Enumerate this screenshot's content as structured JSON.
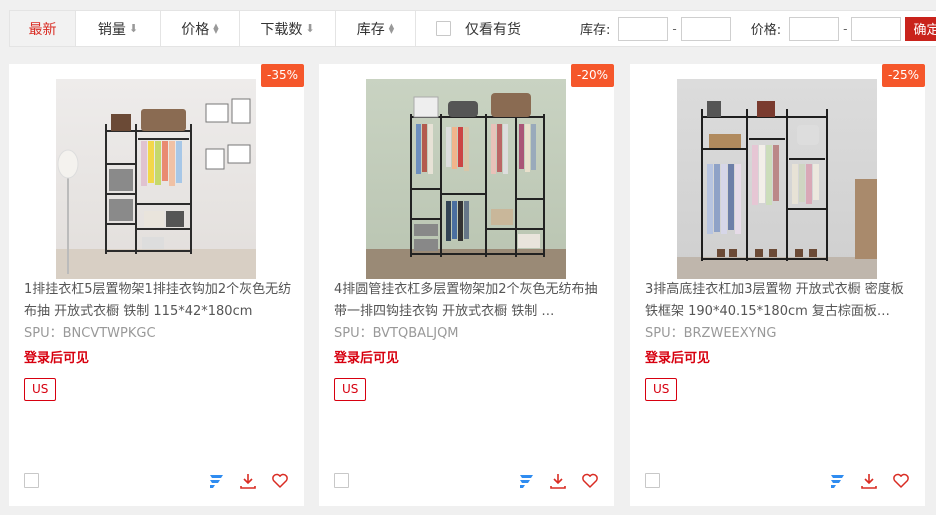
{
  "sort": {
    "newest": "最新",
    "sales": "销量",
    "price": "价格",
    "downloads": "下载数",
    "stock": "库存",
    "in_stock_only": "仅看有货",
    "stock_range_label": "库存:",
    "price_range_label": "价格:",
    "dash": "-",
    "confirm": "确定",
    "arrow_down": "⬇",
    "arrow_up_small": "▲",
    "arrow_down_small": "▼"
  },
  "colors": {
    "accent_red": "#d92c23",
    "discount_orange": "#f5572b",
    "price_red": "#d7000f",
    "brand_blue": "#2f8cf0"
  },
  "products": [
    {
      "discount": "-35%",
      "title": "1排挂衣杠5层置物架1排挂衣钩加2个灰色无纺布抽 开放式衣橱 铁制 115*42*180cm",
      "spu": "SPU：BNCVTWPKGC",
      "price_text": "登录后可见",
      "region": "US"
    },
    {
      "discount": "-20%",
      "title": "4排圆管挂衣杠多层置物架加2个灰色无纺布抽带一排四钩挂衣钩 开放式衣橱 铁制 …",
      "spu": "SPU：BVTQBALJQM",
      "price_text": "登录后可见",
      "region": "US"
    },
    {
      "discount": "-25%",
      "title": "3排高底挂衣杠加3层置物 开放式衣橱 密度板 铁框架 190*40.15*180cm 复古棕面板…",
      "spu": "SPU：BRZWEEXYNG",
      "price_text": "登录后可见",
      "region": "US"
    }
  ]
}
